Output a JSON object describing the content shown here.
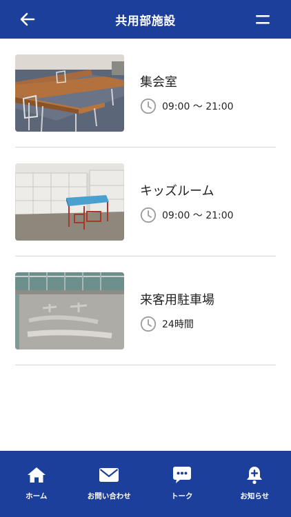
{
  "header": {
    "title": "共用部施設"
  },
  "facilities": [
    {
      "name": "集会室",
      "hours": "09:00 〜 21:00",
      "icon": "clock-icon"
    },
    {
      "name": "キッズルーム",
      "hours": "09:00 〜 21:00",
      "icon": "clock-icon"
    },
    {
      "name": "来客用駐車場",
      "hours": "24時間",
      "icon": "clock-icon"
    }
  ],
  "tabbar": {
    "items": [
      {
        "label": "ホーム",
        "icon": "home-icon"
      },
      {
        "label": "お問い合わせ",
        "icon": "mail-icon"
      },
      {
        "label": "トーク",
        "icon": "chat-icon"
      },
      {
        "label": "お知らせ",
        "icon": "bell-icon"
      }
    ]
  },
  "colors": {
    "brand": "#1d3f9c",
    "divider": "#d6d6d6",
    "clock_icon": "#9a9a9a"
  }
}
